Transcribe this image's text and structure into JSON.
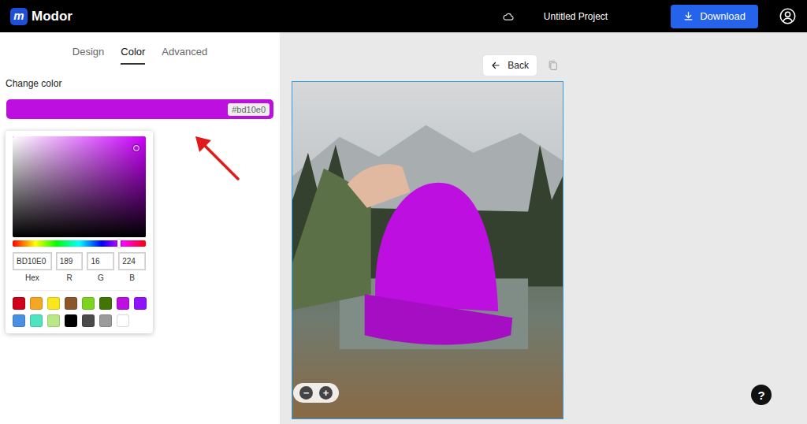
{
  "header": {
    "logo_letter": "m",
    "app_name": "Modor",
    "project_title": "Untitled Project",
    "download_label": "Download"
  },
  "tabs": [
    {
      "label": "Design",
      "selected": false
    },
    {
      "label": "Color",
      "selected": true
    },
    {
      "label": "Advanced",
      "selected": false
    }
  ],
  "color_panel": {
    "label": "Change color",
    "hex_badge": "#bd10e0",
    "color": "#bd10e0"
  },
  "picker": {
    "saturation": 0.93,
    "brightness": 0.88,
    "hue_level": 0.8,
    "fields": [
      {
        "label": "Hex",
        "value": "BD10E0"
      },
      {
        "label": "R",
        "value": "189"
      },
      {
        "label": "G",
        "value": "16"
      },
      {
        "label": "B",
        "value": "224"
      }
    ],
    "swatches": [
      {
        "color": "#d0021b"
      },
      {
        "color": "#f5a623"
      },
      {
        "color": "#f8e71c"
      },
      {
        "color": "#8b572a"
      },
      {
        "color": "#7ed321"
      },
      {
        "color": "#417505"
      },
      {
        "color": "#bd10e0"
      },
      {
        "color": "#9013fe"
      },
      {
        "color": "#4a90e2"
      },
      {
        "color": "#50e3c2"
      },
      {
        "color": "#b8e986"
      },
      {
        "color": "#000000"
      },
      {
        "color": "#4a4a4a"
      },
      {
        "color": "#9b9b9b"
      },
      {
        "color": "#ffffff"
      }
    ]
  },
  "canvas": {
    "back_label": "Back",
    "zoom_out": "−",
    "zoom_in": "+"
  },
  "help": {
    "label": "?"
  }
}
